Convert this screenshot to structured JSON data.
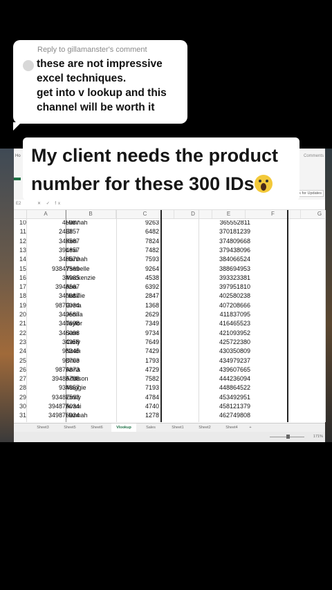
{
  "comment": {
    "reply_header": "Reply to gillamanster's comment",
    "text": "these are not impressive\nexcel techniques.\nget into v lookup and this\nchannel will be worth it"
  },
  "caption": {
    "line1": "My client needs the product",
    "line2": "number for these 300 IDs",
    "emoji": "scream-emoji"
  },
  "excel": {
    "ribbon": {
      "home_tab": "Ho",
      "comments_button": "Comments",
      "check_updates_button": "ck for Updates"
    },
    "formula_bar": {
      "name_box": "E2",
      "fx_label": "fx"
    },
    "columns": [
      "A",
      "B",
      "C",
      "D",
      "E",
      "F",
      "G"
    ],
    "rows": [
      {
        "n": "10",
        "id": "45987",
        "name": "Hannah",
        "value": "9263",
        "product": "365552811"
      },
      {
        "n": "11",
        "id": "243857",
        "name": "Eli",
        "value": "6482",
        "product": "370181239"
      },
      {
        "n": "12",
        "id": "349587",
        "name": "Ken",
        "value": "7824",
        "product": "374809668"
      },
      {
        "n": "13",
        "id": "394857",
        "name": "Lexi",
        "value": "7482",
        "product": "379438096"
      },
      {
        "n": "14",
        "id": "348570",
        "name": "Hannah",
        "value": "7593",
        "product": "384066524"
      },
      {
        "n": "15",
        "id": "93847569",
        "name": "Ysabelle",
        "value": "9264",
        "product": "388694953"
      },
      {
        "n": "16",
        "id": "34985",
        "name": "Mackenzie",
        "value": "4538",
        "product": "393323381"
      },
      {
        "n": "17",
        "id": "3948567",
        "name": "Ana",
        "value": "6392",
        "product": "397951810"
      },
      {
        "n": "18",
        "id": "340687",
        "name": "Natalie",
        "value": "2847",
        "product": "402580238"
      },
      {
        "n": "19",
        "id": "9879034",
        "name": "Greta",
        "value": "1368",
        "product": "407208666"
      },
      {
        "n": "20",
        "id": "349587",
        "name": "Jenna",
        "value": "2629",
        "product": "411837095"
      },
      {
        "n": "21",
        "id": "340698",
        "name": "Taylor",
        "value": "7349",
        "product": "416465523"
      },
      {
        "n": "22",
        "id": "346098",
        "name": "Sam",
        "value": "9734",
        "product": "421093952"
      },
      {
        "n": "23",
        "id": "34958",
        "name": "Carly",
        "value": "7649",
        "product": "425722380"
      },
      {
        "n": "24",
        "id": "98345",
        "name": "Noah",
        "value": "7429",
        "product": "430350809"
      },
      {
        "n": "25",
        "id": "98793",
        "name": "Dixie",
        "value": "1793",
        "product": "434979237"
      },
      {
        "n": "26",
        "id": "9879873",
        "name": "Anna",
        "value": "4729",
        "product": "439607665"
      },
      {
        "n": "27",
        "id": "39485798",
        "name": "Addison",
        "value": "7582",
        "product": "444236094"
      },
      {
        "n": "28",
        "id": "934857",
        "name": "Maggie",
        "value": "7193",
        "product": "448864522"
      },
      {
        "n": "29",
        "id": "93487593",
        "name": "Emily",
        "value": "4784",
        "product": "453492951"
      },
      {
        "n": "30",
        "id": "394875034",
        "name": "Avani",
        "value": "4740",
        "product": "458121379"
      },
      {
        "n": "31",
        "id": "349876934",
        "name": "Hannah",
        "value": "1278",
        "product": "462749808"
      }
    ],
    "sheet_tabs": [
      "Sheet3",
      "Sheet5",
      "Sheet6",
      "Vlookup",
      "Sales",
      "Sheet1",
      "Sheet2",
      "Sheet4",
      "+"
    ],
    "active_tab": "Vlookup",
    "zoom": "171%"
  }
}
